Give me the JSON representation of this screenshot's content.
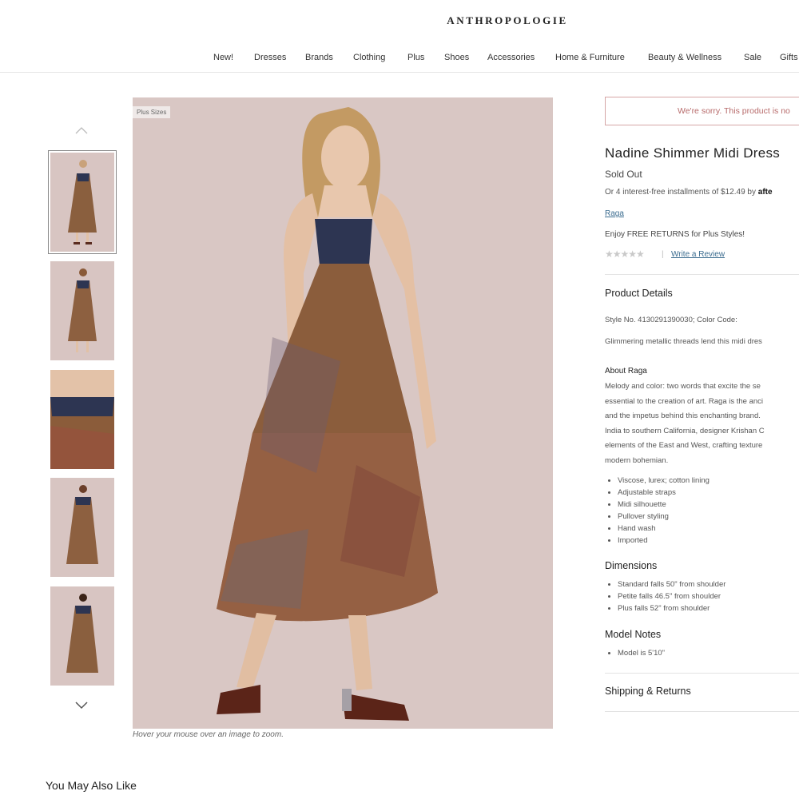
{
  "header": {
    "logo": "ANTHROPOLOGIE",
    "nav": [
      "New!",
      "Dresses",
      "Brands",
      "Clothing",
      "Plus",
      "Shoes",
      "Accessories",
      "Home & Furniture",
      "Beauty & Wellness",
      "Sale",
      "Gifts"
    ]
  },
  "gallery": {
    "badge": "Plus Sizes",
    "zoom_hint": "Hover your mouse over an image to zoom.",
    "thumbnail_count": 5,
    "active_thumbnail": 1
  },
  "product": {
    "sorry_message": "We're sorry. This product is no",
    "title": "Nadine Shimmer Midi Dress",
    "status": "Sold Out",
    "installments_prefix": "Or 4 interest-free installments of $12.49 by ",
    "installments_brand": "afte",
    "brand": "Raga",
    "returns": "Enjoy FREE RETURNS for Plus Styles!",
    "stars": "★★★★★",
    "rating_value": 0,
    "write_review": "Write a Review"
  },
  "details": {
    "heading": "Product Details",
    "style_line": "Style No. 4130291390030; Color Code:",
    "description": "Glimmering metallic threads lend this midi dres",
    "about_heading": "About Raga",
    "about_lines": [
      "Melody and color: two words that excite the se",
      "essential to the creation of art. Raga is the anci",
      "and the impetus behind this enchanting brand.",
      "India to southern California, designer Krishan C",
      "elements of the East and West, crafting texture",
      "modern bohemian."
    ],
    "features": [
      "Viscose, lurex; cotton lining",
      "Adjustable straps",
      "Midi silhouette",
      "Pullover styling",
      "Hand wash",
      "Imported"
    ]
  },
  "dimensions": {
    "heading": "Dimensions",
    "items": [
      "Standard falls 50\" from shoulder",
      "Petite falls 46.5\" from shoulder",
      "Plus falls 52\" from shoulder"
    ]
  },
  "model_notes": {
    "heading": "Model Notes",
    "items": [
      "Model is 5'10\""
    ]
  },
  "shipping": {
    "heading": "Shipping & Returns"
  },
  "recommendations": {
    "heading": "You May Also Like"
  },
  "colors": {
    "background": "#ffffff",
    "link": "#3b6c8f",
    "alert_border": "#d6a6a6",
    "alert_text": "#b76a6a",
    "photo_bg": "#d9c7c4"
  }
}
